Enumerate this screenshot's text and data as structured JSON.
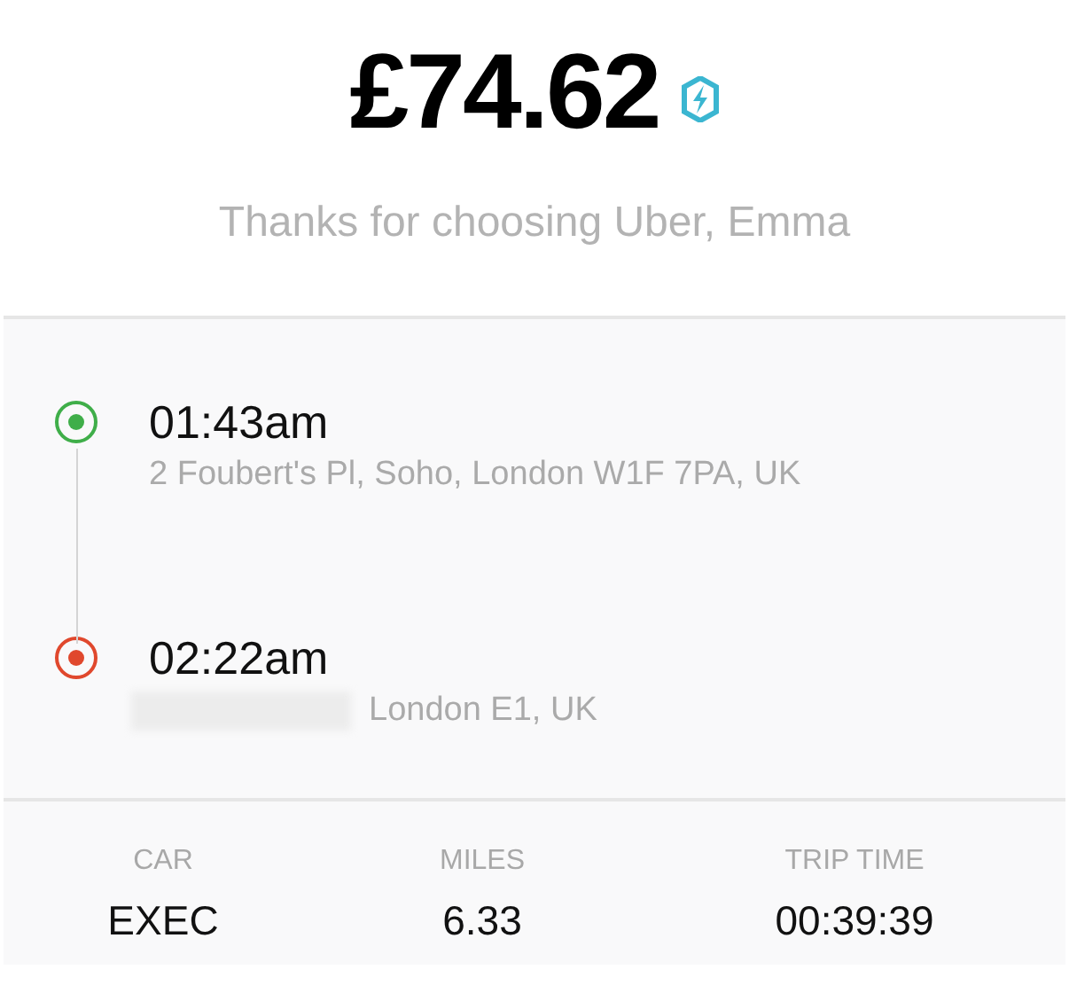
{
  "fare": {
    "amount": "£74.62"
  },
  "thanks": "Thanks for choosing Uber, Emma",
  "stops": [
    {
      "time": "01:43am",
      "address": "2 Foubert's Pl, Soho, London W1F 7PA, UK",
      "color": "#3fae49",
      "redacted": false
    },
    {
      "time": "02:22am",
      "address": "London E1, UK",
      "color": "#e0482d",
      "redacted": true
    }
  ],
  "stats": [
    {
      "label": "CAR",
      "value": "EXEC"
    },
    {
      "label": "MILES",
      "value": "6.33"
    },
    {
      "label": "TRIP TIME",
      "value": "00:39:39"
    }
  ]
}
